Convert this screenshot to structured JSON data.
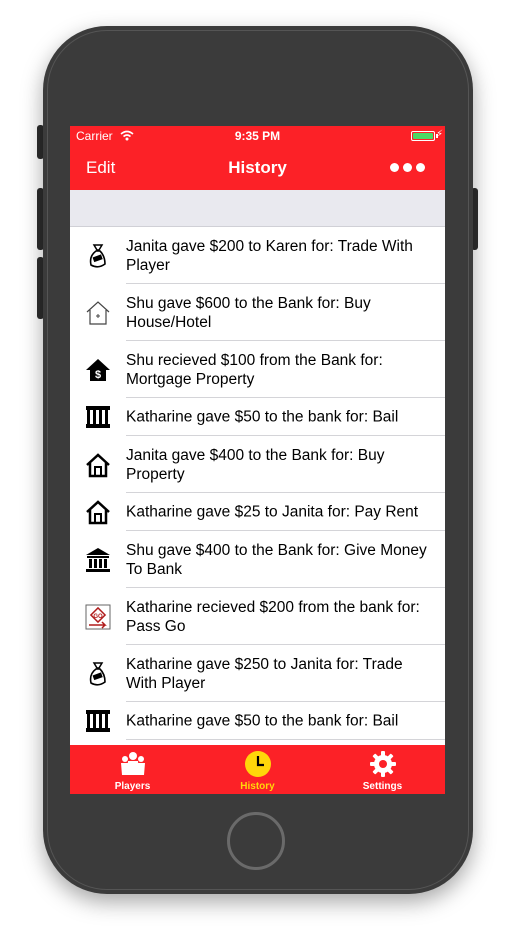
{
  "status": {
    "carrier": "Carrier",
    "time": "9:35 PM",
    "battery_level": 1.0
  },
  "nav": {
    "edit_label": "Edit",
    "title": "History",
    "more_icon": "ellipsis-icon"
  },
  "history": [
    {
      "icon": "money-bag-icon",
      "text": "Janita gave $200 to Karen for: Trade With Player"
    },
    {
      "icon": "house-outline-icon",
      "text": "Shu gave $600 to the Bank for: Buy House/Hotel"
    },
    {
      "icon": "mortgage-house-icon",
      "text": "Shu recieved $100 from the Bank for: Mortgage Property"
    },
    {
      "icon": "jail-icon",
      "text": "Katharine gave $50 to the bank for: Bail"
    },
    {
      "icon": "house-icon",
      "text": "Janita gave $400 to the Bank for: Buy Property"
    },
    {
      "icon": "house-icon",
      "text": "Katharine gave $25 to Janita for: Pay Rent"
    },
    {
      "icon": "bank-icon",
      "text": "Shu gave $400 to the Bank for: Give Money To Bank"
    },
    {
      "icon": "go-tile-icon",
      "text": "Katharine recieved $200 from the bank for: Pass Go"
    },
    {
      "icon": "money-bag-icon",
      "text": "Katharine gave $250 to Janita for: Trade With Player"
    },
    {
      "icon": "jail-icon",
      "text": "Katharine gave $50 to the bank for: Bail"
    }
  ],
  "tabs": [
    {
      "label": "Players",
      "icon": "players-icon",
      "active": false
    },
    {
      "label": "History",
      "icon": "clock-icon",
      "active": true
    },
    {
      "label": "Settings",
      "icon": "gear-icon",
      "active": false
    }
  ],
  "colors": {
    "brand_red": "#fc2127",
    "active_tab": "#ffd60a",
    "section_gray": "#e9e9ef"
  }
}
